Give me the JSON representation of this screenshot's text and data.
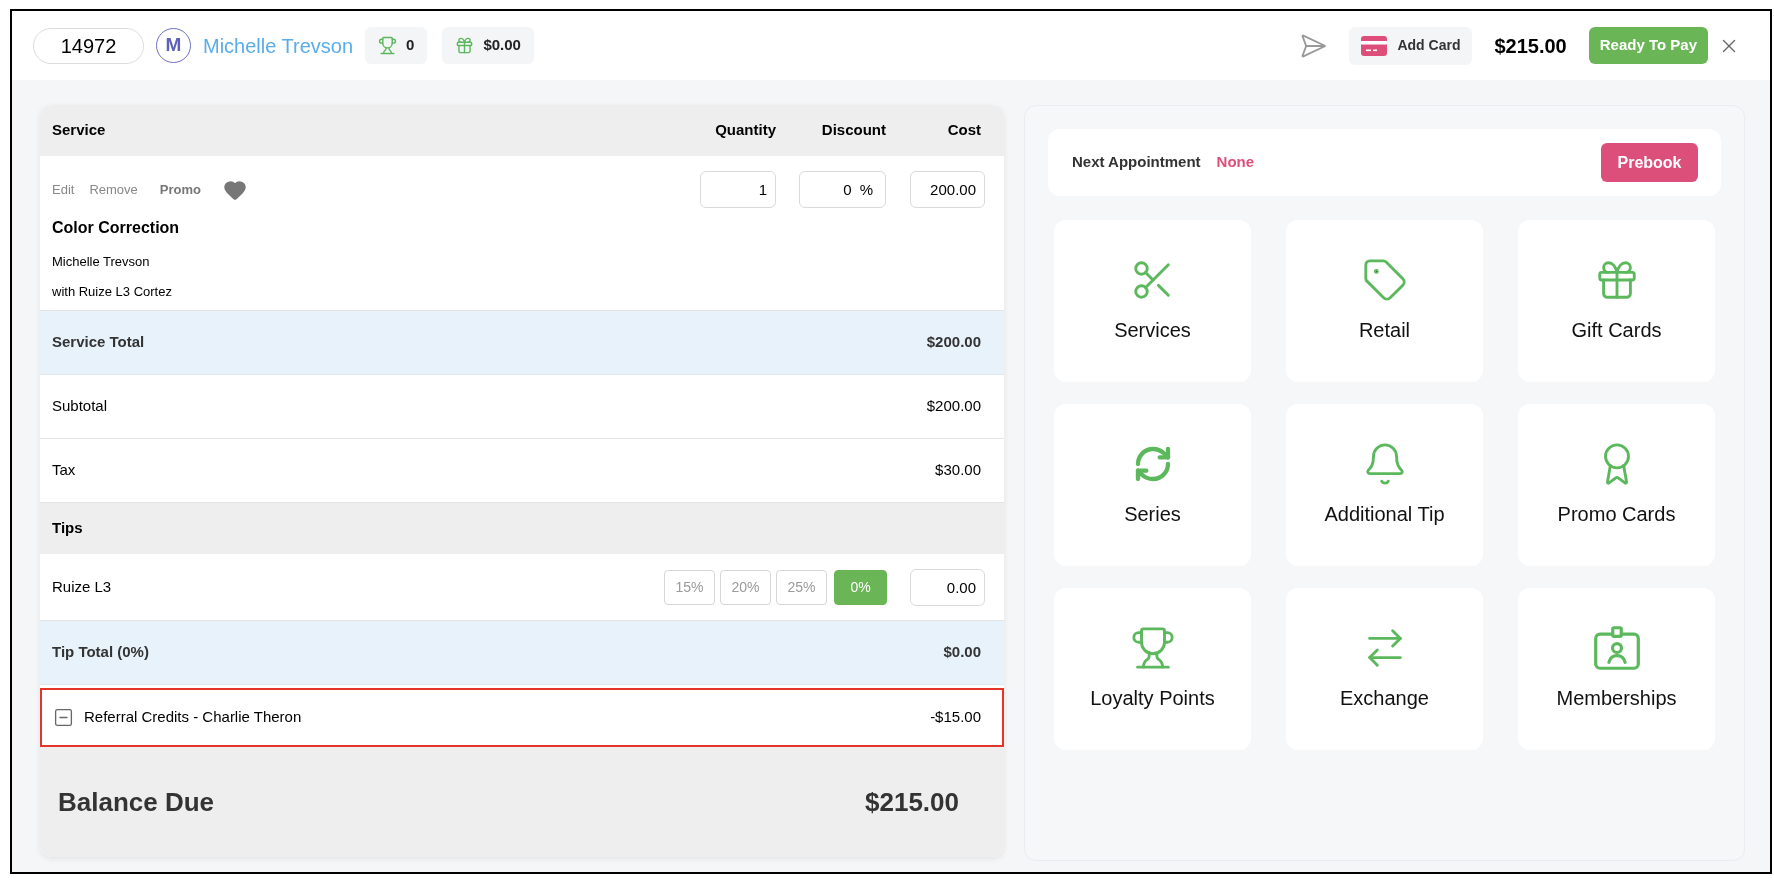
{
  "header": {
    "order_number": "14972",
    "client_initial": "M",
    "client_name": "Michelle Trevson",
    "loyalty_points": "0",
    "gift_balance": "$0.00",
    "add_card": "Add Card",
    "amount_due": "$215.00",
    "pay_button": "Ready To Pay"
  },
  "ticket": {
    "columns": [
      "Service",
      "Quantity",
      "Discount",
      "Cost"
    ],
    "services": [
      {
        "actions": [
          "Edit",
          "Remove",
          "Promo"
        ],
        "name": "Color Correction",
        "client": "Michelle Trevson",
        "staff": "with Ruize L3 Cortez",
        "quantity": "1",
        "discount": "0",
        "discount_unit": "%",
        "cost": "200.00"
      }
    ],
    "rows": [
      {
        "kind": "total",
        "label": "Service Total",
        "value": "$200.00"
      },
      {
        "kind": "line",
        "label": "Subtotal",
        "value": "$200.00"
      },
      {
        "kind": "line",
        "label": "Tax",
        "value": "$30.00"
      },
      {
        "kind": "section",
        "label": "Tips"
      },
      {
        "kind": "tip",
        "label": "Ruize L3",
        "options": [
          {
            "label": "15%",
            "selected": false
          },
          {
            "label": "20%",
            "selected": false
          },
          {
            "label": "25%",
            "selected": false
          },
          {
            "label": "0%",
            "selected": true
          }
        ],
        "amount": "0.00"
      },
      {
        "kind": "total",
        "label": "Tip Total (0%)",
        "value": "$0.00"
      },
      {
        "kind": "credit",
        "label": "Referral Credits - Charlie Theron",
        "value": "-$15.00",
        "highlighted": true
      }
    ],
    "balance": {
      "label": "Balance Due",
      "value": "$215.00"
    }
  },
  "side_panel": {
    "next_appointment": {
      "label": "Next Appointment",
      "value": "None",
      "button": "Prebook"
    },
    "tiles": [
      {
        "label": "Services"
      },
      {
        "label": "Retail"
      },
      {
        "label": "Gift Cards"
      },
      {
        "label": "Series"
      },
      {
        "label": "Additional Tip"
      },
      {
        "label": "Promo Cards"
      },
      {
        "label": "Loyalty Points"
      },
      {
        "label": "Exchange"
      },
      {
        "label": "Memberships"
      }
    ]
  }
}
